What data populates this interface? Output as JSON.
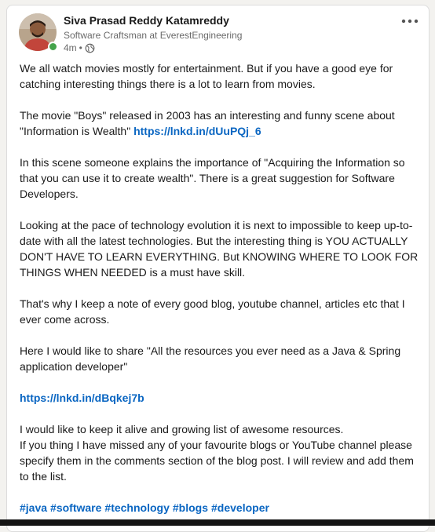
{
  "author": {
    "name": "Siva Prasad Reddy Katamreddy",
    "headline": "Software Craftsman at EverestEngineering",
    "time": "4m",
    "visibility_icon": "globe-icon"
  },
  "menu": {
    "icon": "more-horizontal-icon"
  },
  "post": {
    "p1": "We all watch movies mostly for entertainment. But if you have a good eye for catching interesting things there is a lot to learn from movies.",
    "p2_text": "The movie \"Boys\" released in 2003 has an interesting and funny scene about \"Information is Wealth\"",
    "p2_link": "https://lnkd.in/dUuPQj_6",
    "p3": "In this scene someone explains the importance of \"Acquiring the Information so that you can use it to create wealth\". There is a great suggestion for Software Developers.",
    "p4": "Looking at the pace of technology evolution it is next to impossible to keep up-to-date with all the latest technologies. But the interesting thing is YOU ACTUALLY DON'T HAVE TO LEARN EVERYTHING. But KNOWING WHERE TO LOOK FOR THINGS WHEN NEEDED is a must have skill.",
    "p5": "That's why I keep a note of every good blog, youtube channel, articles etc that I ever come across.",
    "p6": "Here I would like to share \"All the resources you ever need as a Java & Spring application developer\"",
    "p7_link": "https://lnkd.in/dBqkej7b",
    "p8_line1": "I would like to keep it alive and growing list of awesome resources.",
    "p8_line2": "If you thing I have missed any of your favourite blogs or YouTube channel please specify them in the comments section of the blog post. I will review and add them to the list.",
    "hashtags": [
      "#java",
      "#software",
      "#technology",
      "#blogs",
      "#developer"
    ]
  },
  "colors": {
    "link": "#0a66c2",
    "online": "#44a34a"
  }
}
